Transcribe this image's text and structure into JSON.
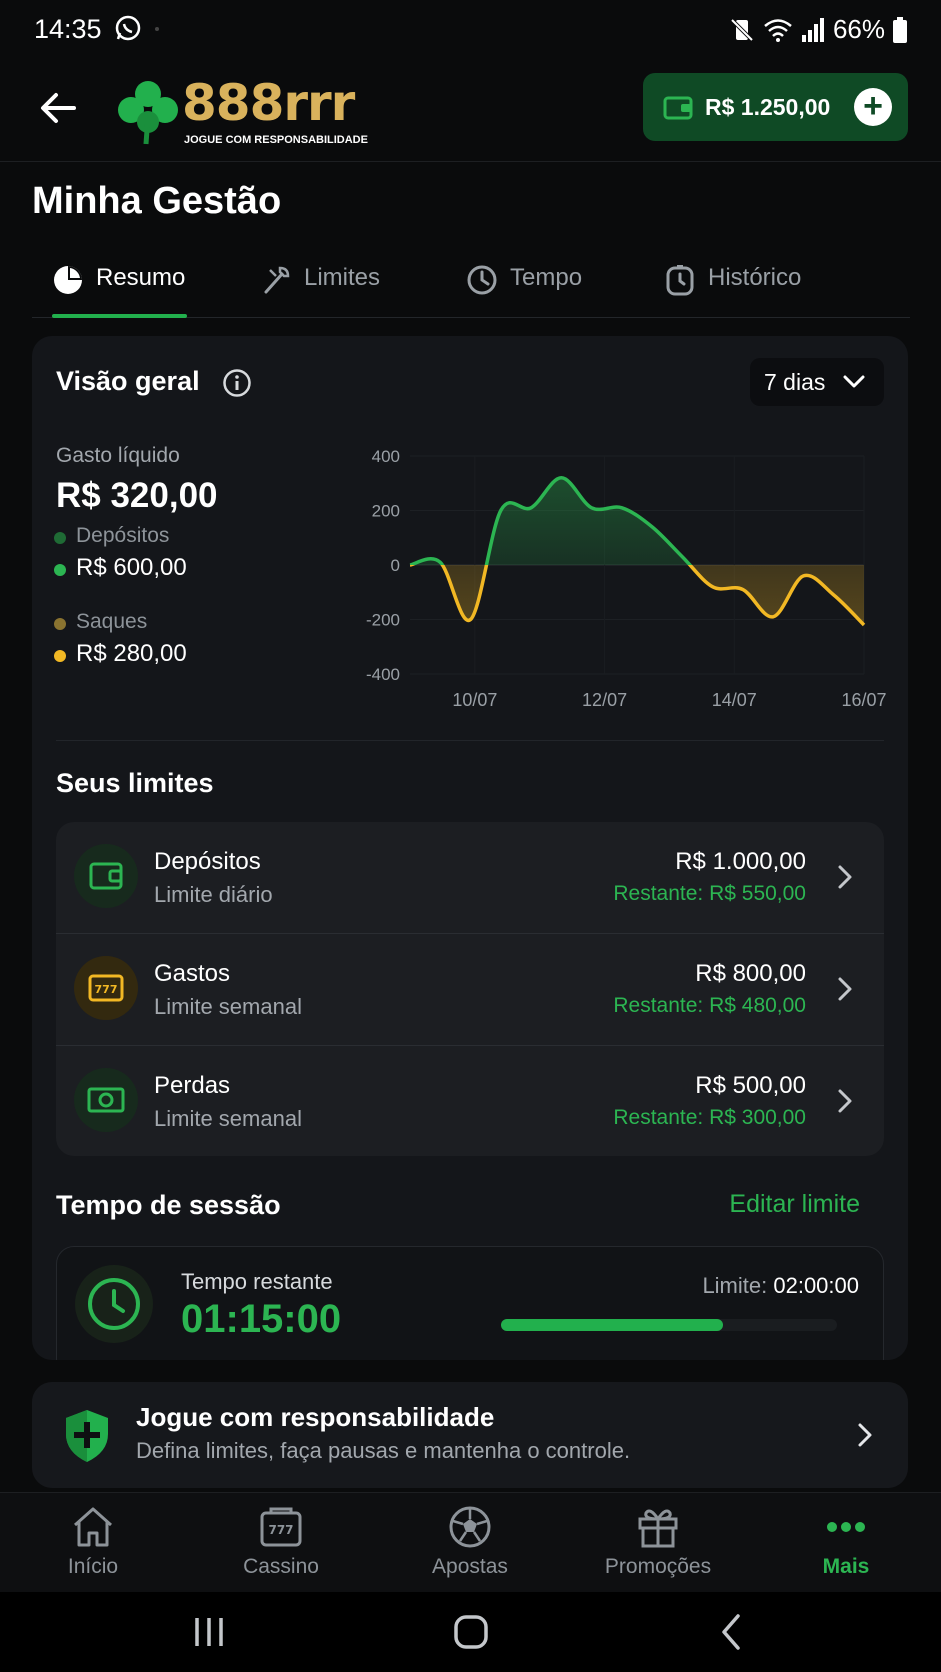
{
  "status": {
    "time": "14:35",
    "battery": "66%"
  },
  "header": {
    "brand": "888rrr",
    "tagline": "JOGUE COM RESPONSABILIDADE",
    "balance": "R$ 1.250,00"
  },
  "page": {
    "title": "Minha Gestão"
  },
  "tabs": [
    {
      "label": "Resumo",
      "active": true
    },
    {
      "label": "Limites",
      "active": false
    },
    {
      "label": "Tempo",
      "active": false
    },
    {
      "label": "Histórico",
      "active": false
    }
  ],
  "overview": {
    "title": "Visão geral",
    "range": "7 dias",
    "net_label": "Gasto líquido",
    "net_value": "R$ 320,00",
    "deposits_label": "Depósitos",
    "deposits_value": "R$ 600,00",
    "withdrawals_label": "Saques",
    "withdrawals_value": "R$ 280,00"
  },
  "chart_data": {
    "type": "area",
    "x_ticks": [
      "10/07",
      "12/07",
      "14/07",
      "16/07"
    ],
    "y_ticks": [
      400,
      200,
      0,
      -200,
      -400
    ],
    "ylim": [
      -400,
      400
    ],
    "x_range": [
      "09/07",
      "16/07"
    ],
    "series": [
      {
        "x": [
          "09/07",
          "09/07",
          "10/07",
          "10/07",
          "11/07",
          "11/07",
          "12/07",
          "12/07",
          "13/07",
          "13/07",
          "14/07",
          "14/07",
          "15/07",
          "15/07",
          "16/07",
          "16/07"
        ],
        "values": [
          0,
          10,
          -200,
          200,
          210,
          320,
          210,
          210,
          140,
          30,
          -80,
          -90,
          -190,
          -40,
          -110,
          -220
        ]
      }
    ],
    "positive_color": "#2cb552",
    "negative_color": "#f2b824",
    "grid": true
  },
  "limits": {
    "title": "Seus limites",
    "items": [
      {
        "name": "Depósitos",
        "period": "Limite diário",
        "amount": "R$ 1.000,00",
        "remaining": "Restante: R$ 550,00",
        "icon": "wallet-icon"
      },
      {
        "name": "Gastos",
        "period": "Limite semanal",
        "amount": "R$ 800,00",
        "remaining": "Restante: R$ 480,00",
        "icon": "slot-machine-icon"
      },
      {
        "name": "Perdas",
        "period": "Limite semanal",
        "amount": "R$ 500,00",
        "remaining": "Restante: R$ 300,00",
        "icon": "cash-icon"
      }
    ]
  },
  "session": {
    "title": "Tempo de sessão",
    "edit_label": "Editar limite",
    "remaining_label": "Tempo restante",
    "remaining_value": "01:15:00",
    "limit_label": "Limite:",
    "limit_value": "02:00:00",
    "progress": 0.66
  },
  "responsible": {
    "title": "Jogue com responsabilidade",
    "subtitle": "Defina limites, faça pausas e mantenha o controle."
  },
  "nav": [
    {
      "label": "Início",
      "icon": "home-icon",
      "active": false
    },
    {
      "label": "Cassino",
      "icon": "slot-machine-icon",
      "active": false
    },
    {
      "label": "Apostas",
      "icon": "soccer-ball-icon",
      "active": false
    },
    {
      "label": "Promoções",
      "icon": "gift-icon",
      "active": false
    },
    {
      "label": "Mais",
      "icon": "more-dots-icon",
      "active": true
    }
  ]
}
